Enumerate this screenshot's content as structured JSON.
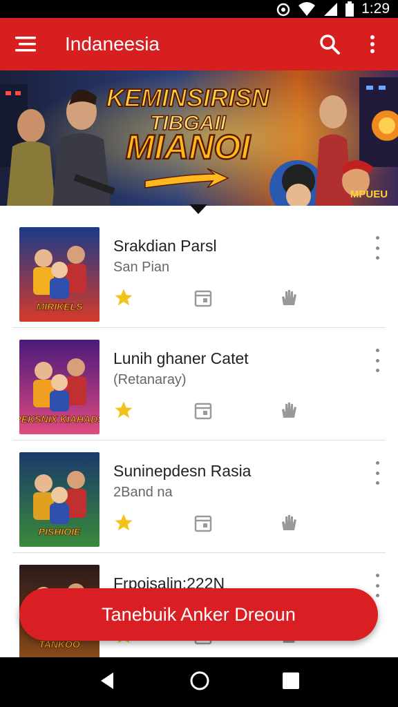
{
  "status": {
    "time": "1:29"
  },
  "appbar": {
    "title": "Indaneesia"
  },
  "banner": {
    "line1": "KEMINSIRISN",
    "line2": "TIBGAII",
    "line3": "MIANOI",
    "corner_text": "MPUEU"
  },
  "games": [
    {
      "name": "Srakdian Parsl",
      "sub": "San Pian",
      "thumb_text": "MIRIKELS",
      "thumb_colors": [
        "#1b3a8a",
        "#d63a2a",
        "#f0b020"
      ]
    },
    {
      "name": "Lunih ghaner Catet",
      "sub": "(Retanaray)",
      "thumb_text": "PEKSNIX KIAHADS",
      "thumb_colors": [
        "#4a1a7a",
        "#e04a80",
        "#f0a020"
      ]
    },
    {
      "name": "Suninepdesn Rasia",
      "sub": "2Band na",
      "thumb_text": "PISHIOIE",
      "thumb_colors": [
        "#1a3a6a",
        "#3a8a3a",
        "#e0a020"
      ]
    },
    {
      "name": "Frpoisalin:222N",
      "sub": "",
      "thumb_text": "TANKOO",
      "thumb_colors": [
        "#2a1a1a",
        "#8a4a1a",
        "#f0c040"
      ]
    }
  ],
  "fab": {
    "label": "Tanebuik Anker Dreoun"
  },
  "colors": {
    "primary": "#d71f1f",
    "star": "#f2c21b",
    "icon_gray": "#999999"
  }
}
